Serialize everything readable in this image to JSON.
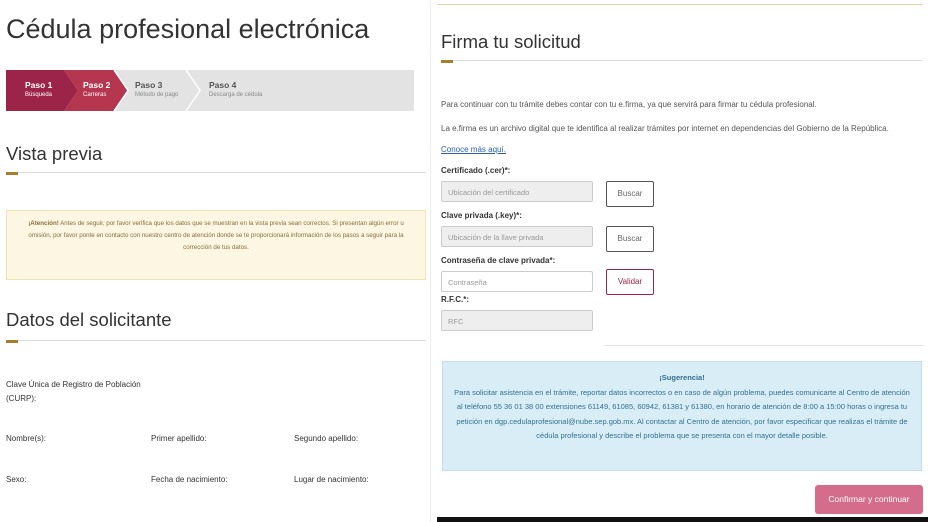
{
  "left": {
    "title": "Cédula profesional electrónica",
    "steps": [
      {
        "title": "Paso 1",
        "subtitle": "Búsqueda",
        "state": "active",
        "color": "#9d2449"
      },
      {
        "title": "Paso 2",
        "subtitle": "Carreras",
        "state": "active",
        "color": "#b5364f"
      },
      {
        "title": "Paso 3",
        "subtitle": "Método de pago",
        "state": "inactive",
        "color": "#e3e3e3"
      },
      {
        "title": "Paso 4",
        "subtitle": "Descarga de cédula",
        "state": "inactive",
        "color": "#e3e3e3"
      }
    ],
    "preview_title": "Vista previa",
    "alert": {
      "strong": "¡Atención!",
      "text": " Antes de seguir, por favor verifica que los datos que se muestran en la vista previa sean correctos. Si presentan algún error u omisión, por favor ponte en contacto con nuestro centro de atención donde se te proporcionará información de los pasos a seguir para la corrección de tus datos."
    },
    "applicant_title": "Datos del solicitante",
    "fields": {
      "curp_line1": "Clave Única de Registro de Población",
      "curp_line2": "(CURP):",
      "nombre": "Nombre(s):",
      "primer_apellido": "Primer apellido:",
      "segundo_apellido": "Segundo apellido:",
      "sexo": "Sexo:",
      "fecha_nacimiento": "Fecha de nacimiento:",
      "lugar_nacimiento": "Lugar de nacimiento:"
    }
  },
  "right": {
    "title": "Firma tu solicitud",
    "para1": "Para continuar con tu trámite debes contar con tu e.firma, ya que servirá para firmar tu cédula profesional.",
    "para2": "La e.firma es un archivo digital que te identifica al realizar trámites por internet en dependencias del Gobierno de la República.",
    "link": "Conoce más aquí.",
    "cert_label": "Certificado (.cer)*:",
    "cert_placeholder": "Ubicación del certificado",
    "cert_button": "Buscar",
    "key_label": "Clave privada (.key)*:",
    "key_placeholder": "Ubicación de la llave privada",
    "key_button": "Buscar",
    "pass_label": "Contraseña de clave privada*:",
    "pass_placeholder": "Contraseña",
    "validate_button": "Validar",
    "rfc_label": "R.F.C.*:",
    "rfc_placeholder": "RFC",
    "suggestion": {
      "heading": "¡Sugerencia!",
      "text": "Para solicitar asistencia en el trámite, reportar datos incorrectos o en caso de algún problema, puedes comunicarte al Centro de atención al teléfono 55 36 01 38 00 extensiones 61149, 61085, 60942, 61381 y 61380, en horario de atención de 8:00 a 15:00 horas o ingresa tu petición en dgp.cedulaprofesional@nube.sep.gob.mx. Al contactar al Centro de atención, por favor especificar que realizas el trámite de cédula profesional y describe el problema que se presenta con el mayor detalle posible."
    },
    "confirm_button": "Confirmar y continuar"
  },
  "colors": {
    "brand": "#9d2449",
    "accent_gold": "#a57f2c",
    "confirm_bg": "#d36d8b",
    "alert_bg": "#fcf6e2",
    "info_bg": "#d9edf7"
  }
}
